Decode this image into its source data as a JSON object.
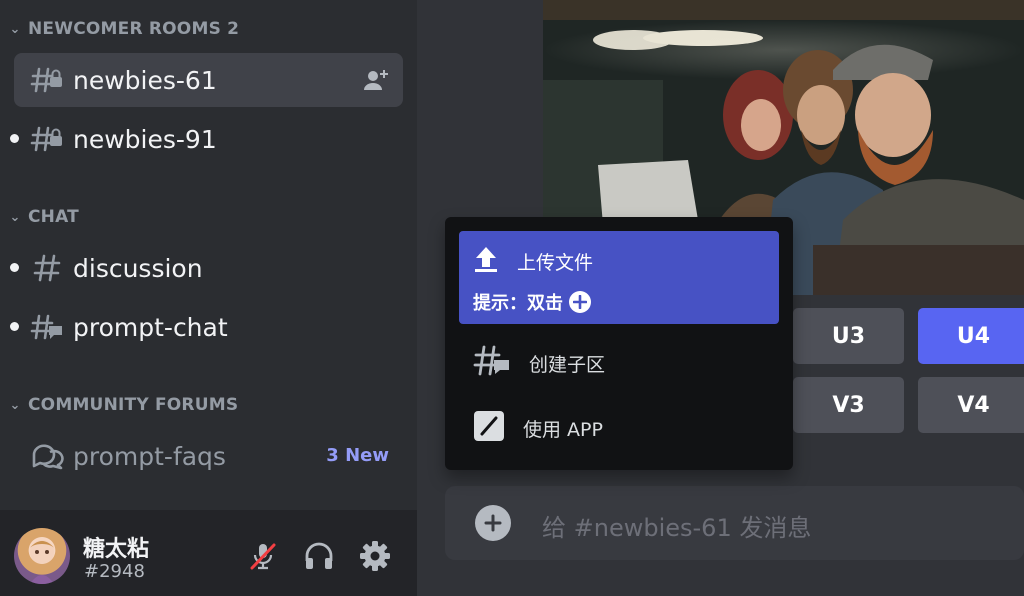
{
  "sidebar": {
    "categories": [
      {
        "label": "NEWCOMER ROOMS 2"
      },
      {
        "label": "CHAT"
      },
      {
        "label": "COMMUNITY FORUMS"
      }
    ],
    "channels": [
      {
        "name": "newbies-61",
        "icon": "locked-thread-hash-icon",
        "active": true
      },
      {
        "name": "newbies-91",
        "icon": "locked-thread-hash-icon",
        "unread": true
      },
      {
        "name": "discussion",
        "icon": "hash-icon",
        "unread": true
      },
      {
        "name": "prompt-chat",
        "icon": "thread-hash-icon",
        "unread": true
      },
      {
        "name": "prompt-faqs",
        "icon": "forum-icon",
        "badge": "3 New"
      }
    ]
  },
  "user": {
    "name": "糖太粘",
    "tag": "#2948",
    "mic_state": "muted"
  },
  "upscale_buttons": {
    "u3": "U3",
    "u4": "U4",
    "v3": "V3",
    "v4": "V4"
  },
  "menu": {
    "upload_label": "上传文件",
    "upload_hint": "提示：双击",
    "thread_label": "创建子区",
    "app_label": "使用 APP"
  },
  "composer": {
    "placeholder": "给 #newbies-61 发消息"
  },
  "colors": {
    "accent": "#5865f2",
    "highlight": "#4752c4",
    "badge": "#949cf7",
    "mute_red": "#f23f43"
  }
}
